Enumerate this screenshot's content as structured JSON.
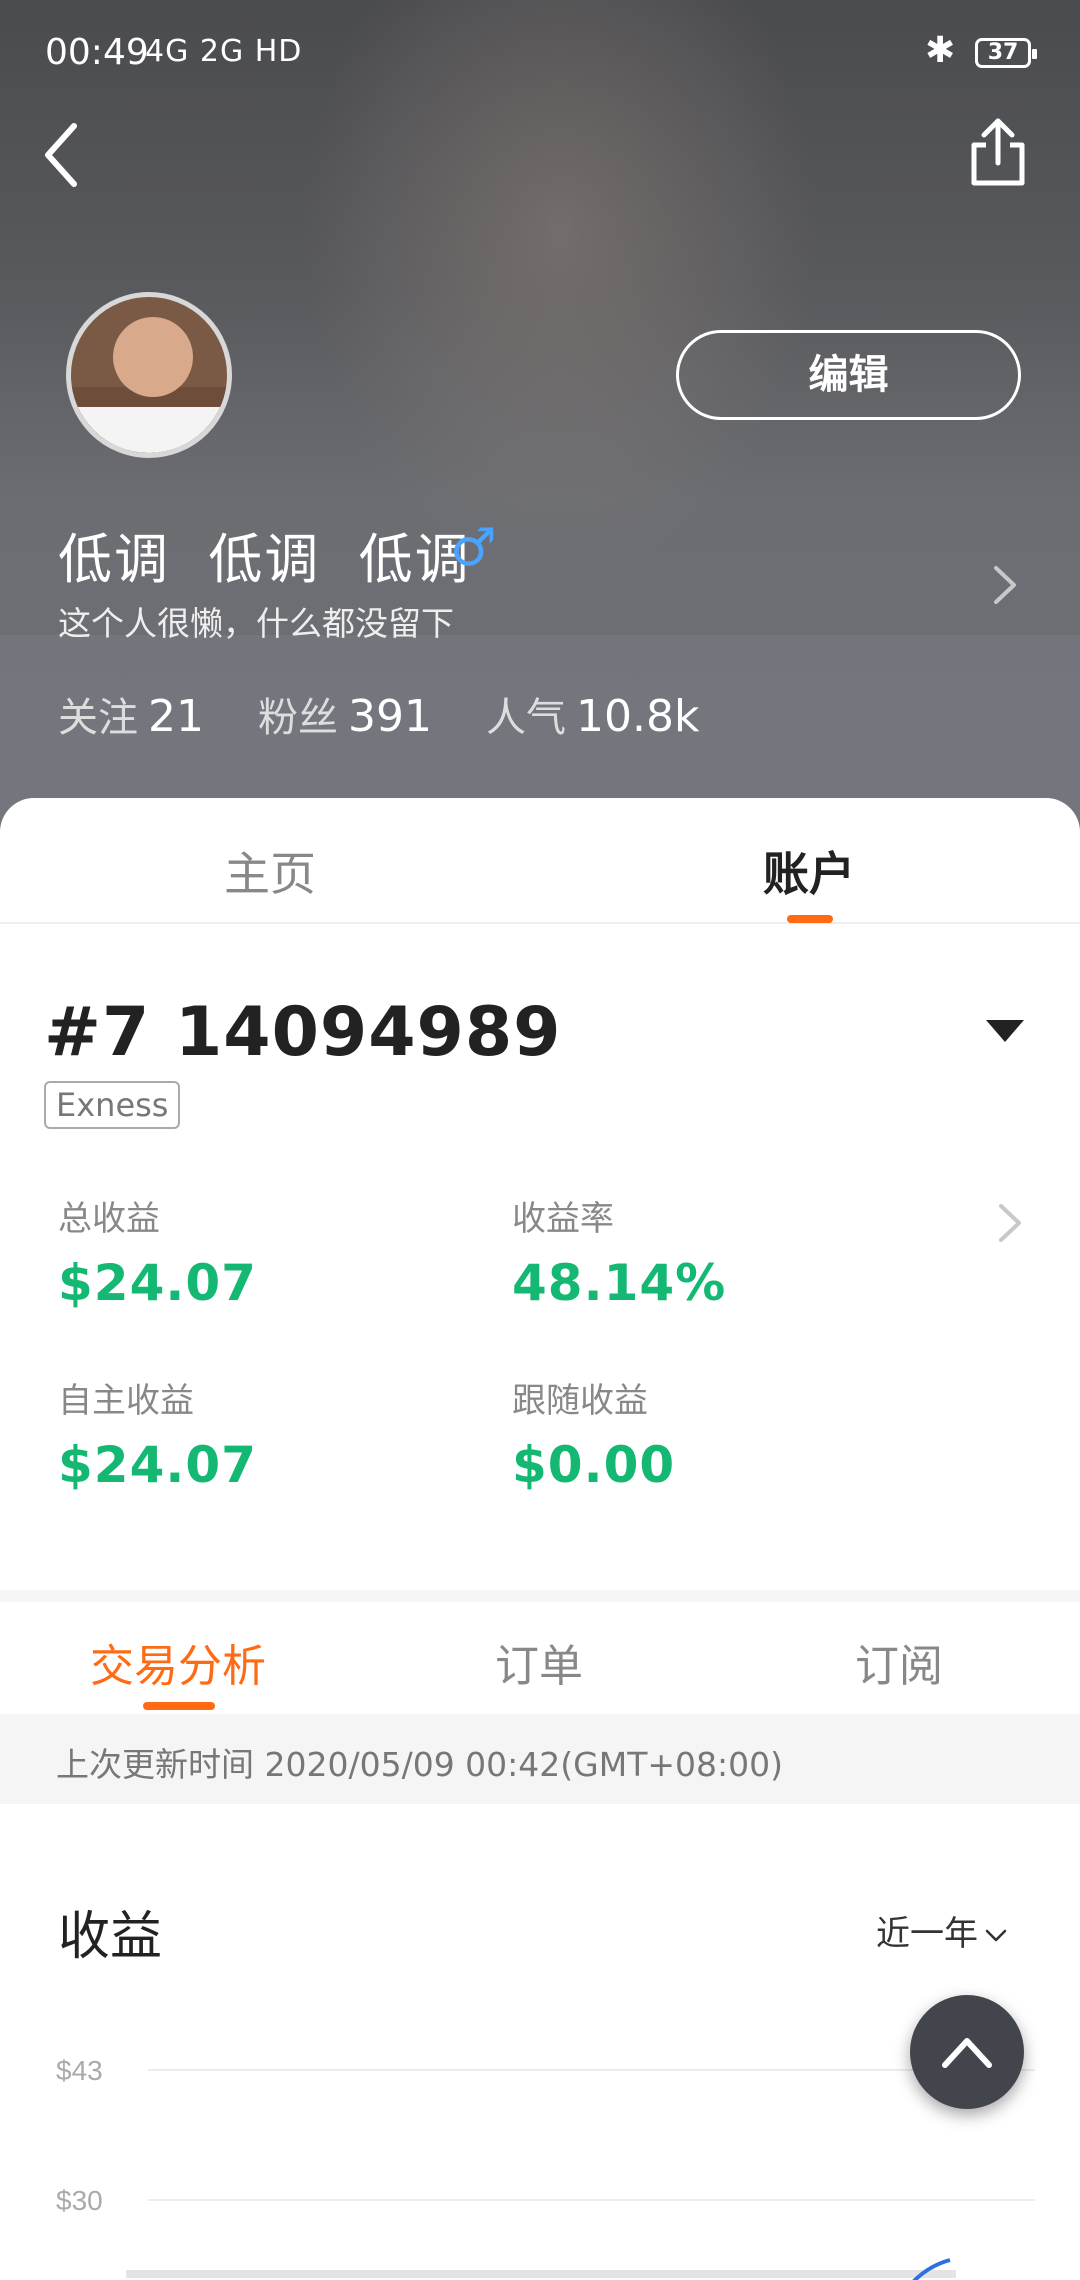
{
  "status_bar": {
    "time": "00:49",
    "signal": "4G 2G HD",
    "battery": "37"
  },
  "profile": {
    "username": "低调  低调  低调",
    "gender_symbol": "♂",
    "bio": "这个人很懒，什么都没留下",
    "edit_label": "编辑",
    "stats": [
      {
        "label": "关注",
        "value": "21"
      },
      {
        "label": "粉丝",
        "value": "391"
      },
      {
        "label": "人气",
        "value": "10.8k"
      }
    ]
  },
  "main_tabs": [
    {
      "label": "主页",
      "selected": false
    },
    {
      "label": "账户",
      "selected": true
    }
  ],
  "account": {
    "number": "#7 14094989",
    "broker": "Exness",
    "metrics": [
      {
        "label": "总收益",
        "value": "$24.07"
      },
      {
        "label": "收益率",
        "value": "48.14%"
      },
      {
        "label": "自主收益",
        "value": "$24.07"
      },
      {
        "label": "跟随收益",
        "value": "$0.00"
      }
    ]
  },
  "sub_tabs": [
    {
      "label": "交易分析",
      "selected": true
    },
    {
      "label": "订单",
      "selected": false
    },
    {
      "label": "订阅",
      "selected": false
    }
  ],
  "update_text": "上次更新时间 2020/05/09 00:42(GMT+08:00)",
  "earnings": {
    "title": "收益",
    "range": "近一年"
  },
  "chart_data": {
    "type": "line",
    "title": "",
    "y_tick_labels": [
      "$43",
      "$30"
    ],
    "series": [],
    "grid": true
  },
  "colors": {
    "accent": "#ff6a13",
    "profit_green": "#15b873",
    "gender_blue": "#4aa3ff"
  }
}
